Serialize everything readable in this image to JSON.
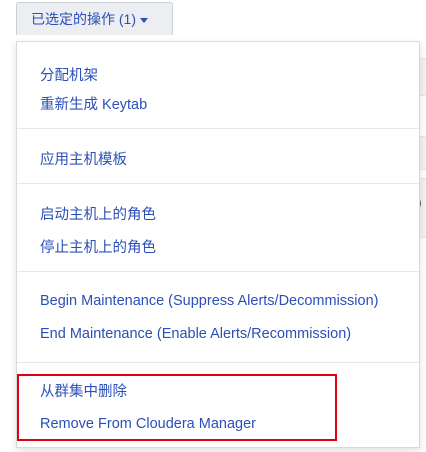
{
  "trigger": {
    "label": "已选定的操作 (1)",
    "caret_icon": "caret-down-icon"
  },
  "background": {
    "partial_text": ")"
  },
  "menu": {
    "groups": [
      {
        "items": [
          "分配机架",
          "重新生成 Keytab"
        ]
      },
      {
        "items": [
          "应用主机模板"
        ]
      },
      {
        "items": [
          "启动主机上的角色",
          "停止主机上的角色"
        ]
      },
      {
        "items": [
          "Begin Maintenance (Suppress Alerts/Decommission)",
          "End Maintenance (Enable Alerts/Recommission)"
        ]
      },
      {
        "items": [
          "从群集中删除",
          "Remove From Cloudera Manager"
        ]
      }
    ]
  },
  "colors": {
    "link": "#2b4fb8",
    "highlight_border": "#e0000f"
  }
}
